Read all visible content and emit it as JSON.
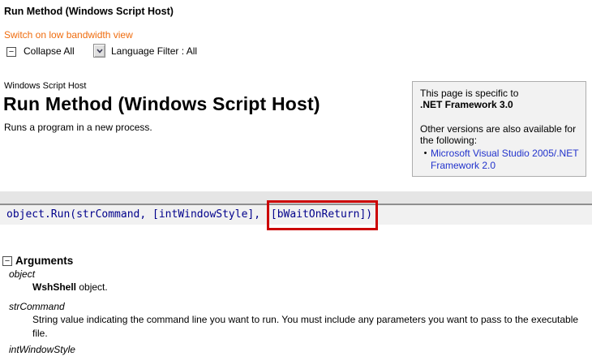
{
  "header": {
    "page_title": "Run Method (Windows Script Host)",
    "low_bandwidth_link": "Switch on low bandwidth view",
    "collapse_all_label": "Collapse All",
    "language_filter_label": "Language Filter : All"
  },
  "article": {
    "eyebrow": "Windows Script Host",
    "title": "Run Method (Windows Script Host)",
    "summary": "Runs a program in a new process."
  },
  "version_box": {
    "intro": "This page is specific to",
    "framework": ".NET Framework 3.0",
    "other_versions": "Other versions are also available for the following:",
    "bullet": "•",
    "link": "Microsoft Visual Studio 2005/.NET Framework 2.0"
  },
  "syntax": {
    "code_before": "object.Run(strCommand, [intWindowStyle], ",
    "code_highlighted": "[bWaitOnReturn])"
  },
  "arguments_section": {
    "title": "Arguments",
    "items": [
      {
        "term": "object",
        "desc_bold": "WshShell",
        "desc": " object."
      },
      {
        "term": "strCommand",
        "desc": "String value indicating the command line you want to run. You must include any parameters you want to pass to the executable file."
      },
      {
        "term": "intWindowStyle",
        "desc": ""
      }
    ]
  },
  "icons": {
    "collapse_minus": "−"
  },
  "colors": {
    "accent_orange": "#ef6c0e",
    "link_blue": "#2233cc",
    "code_navy": "#00008b",
    "annotation_red": "#cc0000"
  }
}
